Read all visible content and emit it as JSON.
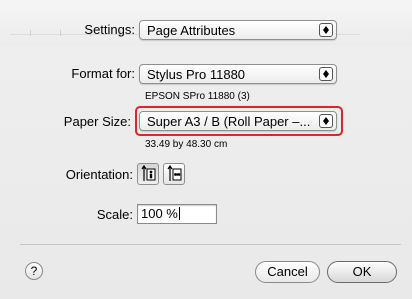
{
  "settings": {
    "label": "Settings:",
    "value": "Page Attributes"
  },
  "format_for": {
    "label": "Format for:",
    "value": "Stylus Pro 11880",
    "subtext": "EPSON SPro 11880 (3)"
  },
  "paper_size": {
    "label": "Paper Size:",
    "value": "Super A3 / B (Roll Paper –...",
    "dimensions": "33.49 by 48.30 cm"
  },
  "orientation": {
    "label": "Orientation:",
    "selected": "portrait"
  },
  "scale": {
    "label": "Scale:",
    "value": "100 %"
  },
  "help": {
    "label": "?"
  },
  "buttons": {
    "cancel": "Cancel",
    "ok": "OK"
  },
  "colors": {
    "highlight": "#e0242b"
  },
  "icons": [
    "up-down-arrows-icon",
    "portrait-orientation-icon",
    "landscape-orientation-icon",
    "help-icon"
  ]
}
